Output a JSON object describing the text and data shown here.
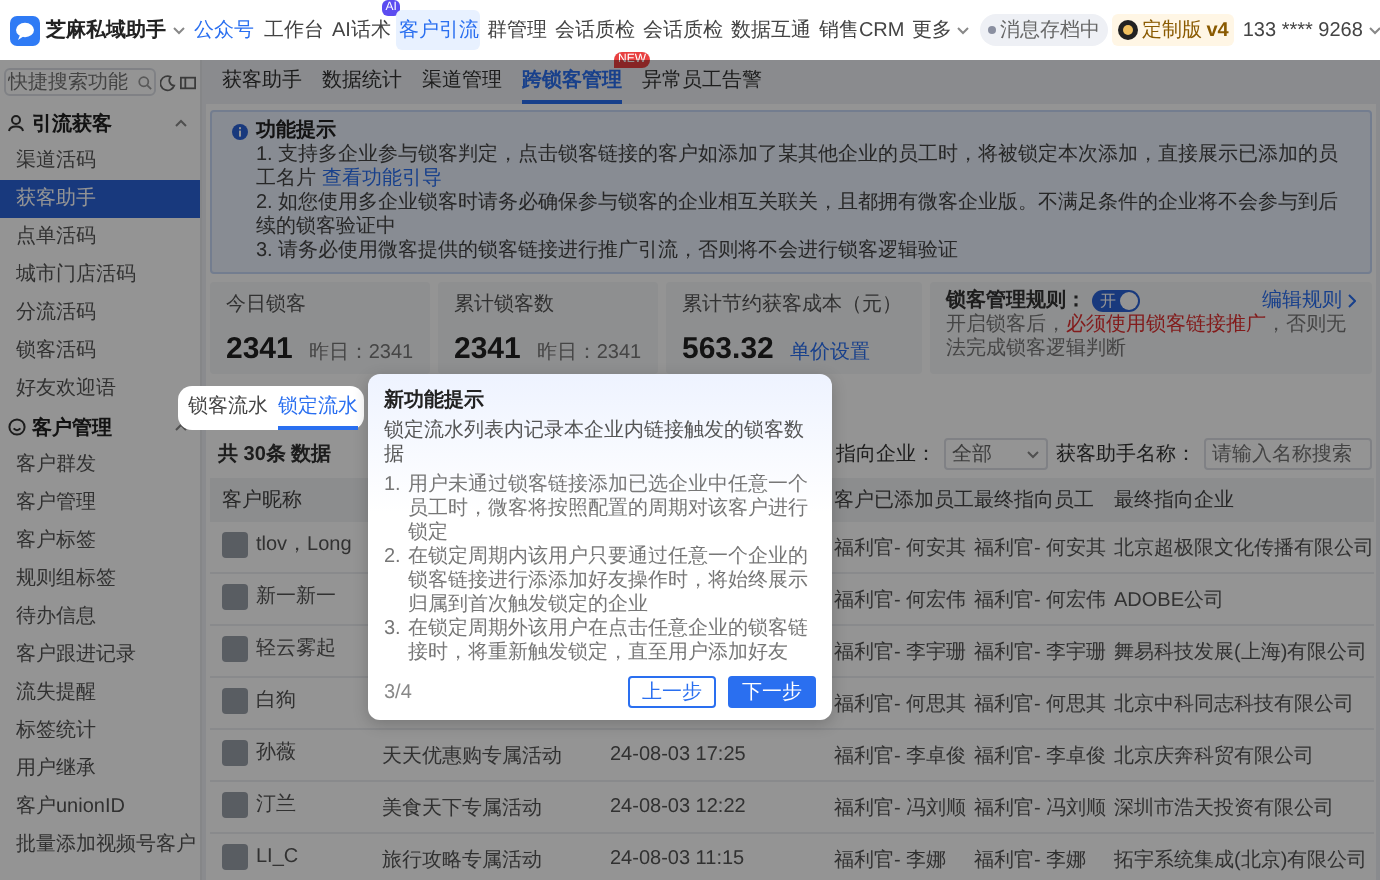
{
  "header": {
    "app_name": "芝麻私域助手",
    "account": "公众号",
    "nav": [
      {
        "label": "工作台",
        "kind": "link",
        "selected": false
      },
      {
        "label": "AI话术",
        "kind": "link",
        "badge": "AI",
        "selected": false
      },
      {
        "label": "客户引流",
        "kind": "link",
        "selected": true
      },
      {
        "label": "群管理",
        "kind": "link",
        "selected": false
      },
      {
        "label": "会话质检",
        "kind": "link",
        "selected": false
      },
      {
        "label": "会话质检",
        "kind": "link",
        "selected": false
      },
      {
        "label": "数据互通",
        "kind": "link",
        "selected": false
      },
      {
        "label": "销售CRM",
        "kind": "link",
        "selected": false
      },
      {
        "label": "更多",
        "kind": "dropdown",
        "selected": false
      }
    ],
    "status": "消息存档中",
    "plan": {
      "label": "定制版",
      "version": "v4"
    },
    "phone": "133 **** 9268"
  },
  "sidebar": {
    "search_placeholder": "快捷搜索功能",
    "groups": [
      {
        "title": "引流获客",
        "expanded": true,
        "items": [
          {
            "label": "渠道活码",
            "selected": false
          },
          {
            "label": "获客助手",
            "selected": true
          },
          {
            "label": "点单活码",
            "selected": false
          },
          {
            "label": "城市门店活码",
            "selected": false
          },
          {
            "label": "分流活码",
            "selected": false
          },
          {
            "label": "锁客活码",
            "selected": false
          },
          {
            "label": "好友欢迎语",
            "selected": false
          }
        ]
      },
      {
        "title": "客户管理",
        "expanded": true,
        "items": [
          {
            "label": "客户群发",
            "selected": false
          },
          {
            "label": "客户管理",
            "selected": false
          },
          {
            "label": "客户标签",
            "selected": false
          },
          {
            "label": "规则组标签",
            "selected": false
          },
          {
            "label": "待办信息",
            "selected": false
          },
          {
            "label": "客户跟进记录",
            "selected": false
          },
          {
            "label": "流失提醒",
            "selected": false
          },
          {
            "label": "标签统计",
            "selected": false
          },
          {
            "label": "用户继承",
            "selected": false
          },
          {
            "label": "客户unionID",
            "selected": false
          },
          {
            "label": "批量添加视频号客户",
            "selected": false
          }
        ]
      }
    ]
  },
  "subtabs": [
    {
      "label": "获客助手",
      "selected": false
    },
    {
      "label": "数据统计",
      "selected": false
    },
    {
      "label": "渠道管理",
      "selected": false
    },
    {
      "label": "跨锁客管理",
      "selected": true,
      "badge": "NEW"
    },
    {
      "label": "异常员工告警",
      "selected": false
    }
  ],
  "notice": {
    "title": "功能提示",
    "lines": [
      {
        "text": "1. 支持多企业参与锁客判定，点击锁客链接的客户如添加了某其他企业的员工时，将被锁定本次添加，直接展示已添加的员工名片",
        "link": "查看功能引导"
      },
      {
        "text": "2. 如您使用多企业锁客时请务必确保参与锁客的企业相互关联关，且都拥有微客企业版。不满足条件的企业将不会参与到后续的锁客验证中"
      },
      {
        "text": "3. 请务必使用微客提供的锁客链接进行推广引流，否则将不会进行锁客逻辑验证"
      }
    ]
  },
  "stats": [
    {
      "label": "今日锁客",
      "value": "2341",
      "sub": "昨日：2341"
    },
    {
      "label": "累计锁客数",
      "value": "2341",
      "sub": "昨日：2341"
    },
    {
      "label": "累计节约获客成本（元）",
      "value": "563.32",
      "link": "单价设置"
    }
  ],
  "rule_card": {
    "label": "锁客管理规则：",
    "toggle": {
      "on": true,
      "text": "开"
    },
    "link": "编辑规则",
    "note": [
      {
        "text": "开启锁客后，",
        "highlight": false
      },
      {
        "text": "必须使用锁客链接推广",
        "highlight": true
      },
      {
        "text": "，否则无法完成锁客逻辑判断",
        "highlight": false
      }
    ]
  },
  "flow_tabs": [
    {
      "label": "锁客流水",
      "selected": false
    },
    {
      "label": "锁定流水",
      "selected": true
    }
  ],
  "filters": {
    "count": "共 30条 数据",
    "company_label": "指向企业：",
    "company_value": "全部",
    "name_label": "获客助手名称：",
    "name_placeholder": "请输入名称搜索"
  },
  "table": {
    "columns": [
      "客户昵称",
      null,
      null,
      "客户已添加员工",
      "最终指向员工",
      "最终指向企业"
    ],
    "rows": [
      {
        "nickname": "tlov，Long",
        "added_staff": "福利官- 何安其",
        "final_staff": "福利官- 何安其",
        "final_company": "北京超极限文化传播有限公司"
      },
      {
        "nickname": "新一新一",
        "added_staff": "福利官- 何宏伟",
        "final_staff": "福利官- 何宏伟",
        "final_company": "ADOBE公司"
      },
      {
        "nickname": "轻云雾起",
        "added_staff": "福利官- 李宇珊",
        "final_staff": "福利官- 李宇珊",
        "final_company": "舞易科技发展(上海)有限公司"
      },
      {
        "nickname": "白狗",
        "added_staff": "福利官- 何思其",
        "final_staff": "福利官- 何思其",
        "final_company": "北京中科同志科技有限公司"
      },
      {
        "nickname": "孙薇",
        "column_2": "天天优惠购专属活动",
        "column_3": "24-08-03 17:25",
        "added_staff": "福利官- 李卓俊",
        "final_staff": "福利官- 李卓俊",
        "final_company": "北京庆奔科贸有限公司"
      },
      {
        "nickname": "汀兰",
        "column_2": "美食天下专属活动",
        "column_3": "24-08-03 12:22",
        "added_staff": "福利官- 冯刘顺",
        "final_staff": "福利官- 冯刘顺",
        "final_company": "深圳市浩天投资有限公司"
      },
      {
        "nickname": "LI_C",
        "column_2": "旅行攻略专属活动",
        "column_3": "24-08-03 11:15",
        "added_staff": "福利官- 李娜",
        "final_staff": "福利官- 李娜",
        "final_company": "拓宇系统集成(北京)有限公司"
      }
    ]
  },
  "popover": {
    "title": "新功能提示",
    "intro": "锁定流水列表内记录本企业内链接触发的锁客数据",
    "steps": [
      {
        "number": "1.",
        "text": "用户未通过锁客链接添加已选企业中任意一个员工时，微客将按照配置的周期对该客户进行锁定"
      },
      {
        "number": "2.",
        "text": "在锁定周期内该用户只要通过任意一个企业的锁客链接进行添添加好友操作时，将始终展示归属到首次触发锁定的企业"
      },
      {
        "number": "3.",
        "text": "在锁定周期外该用户在点击任意企业的锁客链接时，将重新触发锁定，直至用户添加好友"
      }
    ],
    "progress": "3/4",
    "prev": "上一步",
    "next": "下一步"
  }
}
